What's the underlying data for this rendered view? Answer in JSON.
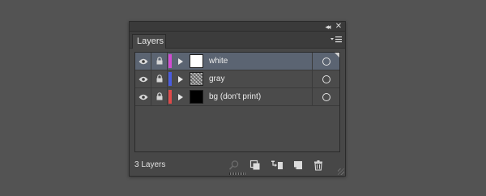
{
  "panel": {
    "tab_label": "Layers",
    "controls": {
      "collapse_glyph": "◂◂",
      "close_glyph": "✕"
    }
  },
  "layers": [
    {
      "name": "white",
      "color": "#d24bd2",
      "thumb": "white",
      "selected": true
    },
    {
      "name": "gray",
      "color": "#4a5ce0",
      "thumb": "pattern",
      "selected": false
    },
    {
      "name": "bg (don't print)",
      "color": "#e04a4a",
      "thumb": "black",
      "selected": false
    }
  ],
  "footer": {
    "layer_count": "3 Layers",
    "buttons": [
      "locate-object",
      "make-clipping-mask",
      "create-sublayer",
      "new-layer",
      "delete"
    ]
  }
}
